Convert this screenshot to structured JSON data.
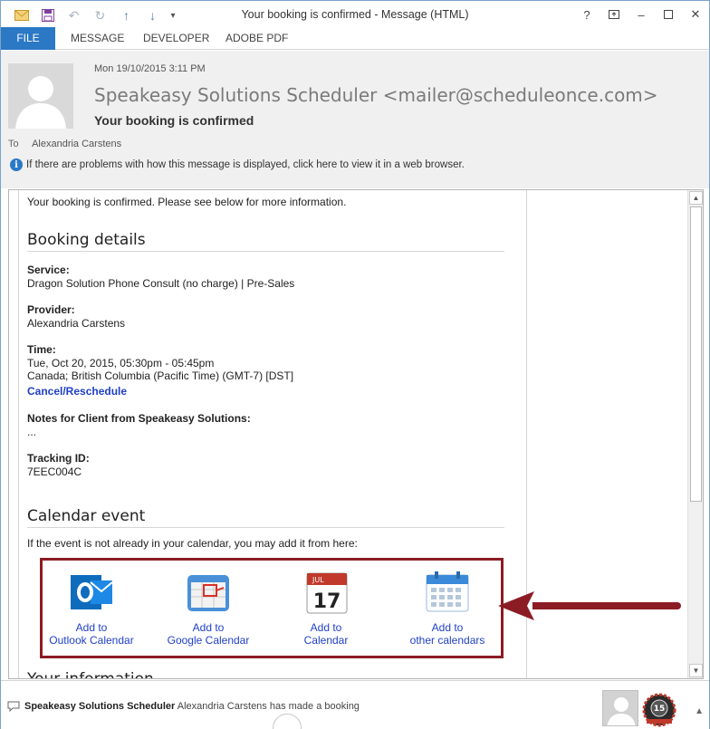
{
  "window": {
    "title": "Your booking is confirmed - Message (HTML)",
    "controls": [
      "?",
      "restore-ribbon",
      "minimize",
      "maximize",
      "close"
    ]
  },
  "ribbon": {
    "tabs": [
      "FILE",
      "MESSAGE",
      "DEVELOPER",
      "ADOBE PDF"
    ]
  },
  "header": {
    "date": "Mon 19/10/2015 3:11 PM",
    "sender": "Speakeasy Solutions Scheduler <mailer@scheduleonce.com>",
    "subject": "Your booking is confirmed",
    "to_label": "To",
    "to_value": "Alexandria Carstens",
    "info_message": "If there are problems with how this message is displayed, click here to view it in a web browser."
  },
  "body": {
    "intro": "Your booking is confirmed. Please see below for more information.",
    "booking_title": "Booking details",
    "service_label": "Service:",
    "service_value": "Dragon Solution Phone Consult (no charge) | Pre-Sales",
    "provider_label": "Provider:",
    "provider_value": "Alexandria Carstens",
    "time_label": "Time:",
    "time_value_1": "Tue, Oct 20, 2015, 05:30pm - 05:45pm",
    "time_value_2": "Canada; British Columbia (Pacific Time) (GMT-7) [DST]",
    "cancel_link": "Cancel/Reschedule",
    "notes_label": "Notes for Client from Speakeasy Solutions:",
    "notes_value": "...",
    "tracking_label": "Tracking ID:",
    "tracking_value": "7EEC004C",
    "calendar_title": "Calendar event",
    "calendar_intro": "If the event is not already in your calendar, you may add it from here:",
    "calendar_options": [
      {
        "line1": "Add to",
        "line2": "Outlook Calendar",
        "icon": "outlook-icon"
      },
      {
        "line1": "Add to",
        "line2": "Google Calendar",
        "icon": "google-calendar-icon"
      },
      {
        "line1": "Add to",
        "line2": "Calendar",
        "icon": "ical-icon"
      },
      {
        "line1": "Add to",
        "line2": "other calendars",
        "icon": "other-calendar-icon"
      }
    ],
    "next_section": "Your information"
  },
  "calendar_icon_day": "17",
  "calendar_icon_month": "JUL",
  "people_pane": {
    "sender": "Speakeasy Solutions Scheduler",
    "message": "Alexandria Carstens has made a booking",
    "badge": "15"
  },
  "colors": {
    "accent": "#2b78c5",
    "link": "#1f3fc7",
    "highlight_border": "#8c1c24"
  }
}
